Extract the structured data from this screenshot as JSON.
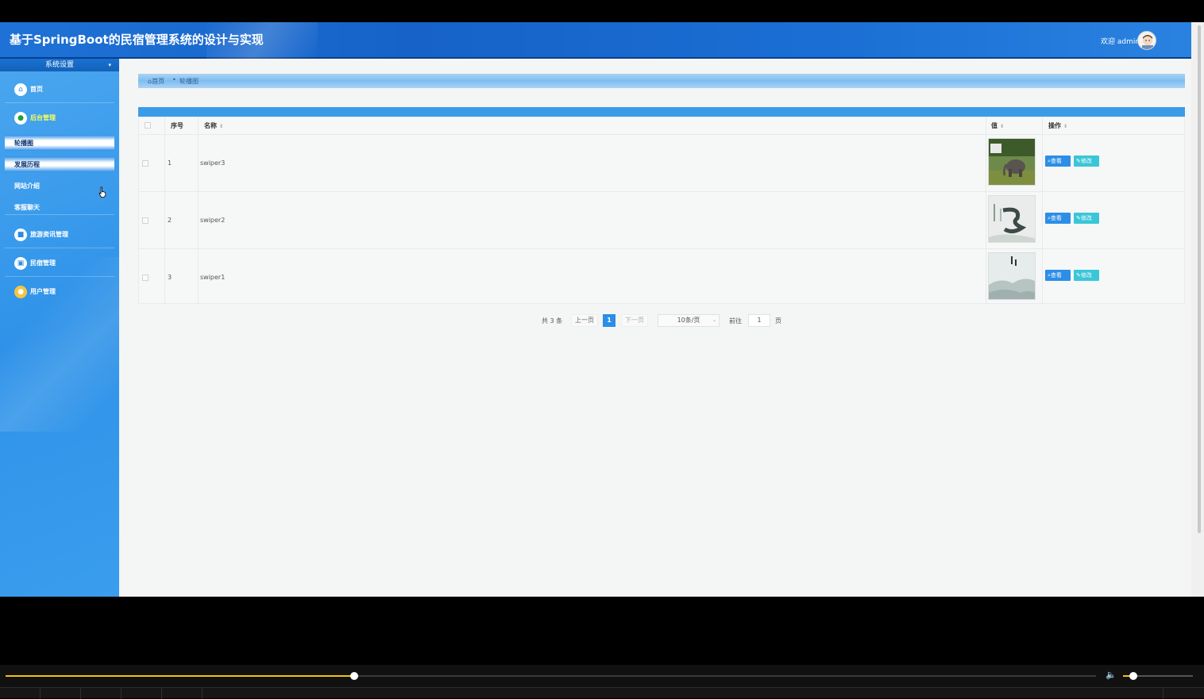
{
  "header": {
    "title": "基于SpringBoot的民宿管理系统的设计与实现",
    "welcome": "欢迎 admin"
  },
  "sidebar": {
    "title": "系统设置",
    "caret": "▾",
    "menu": [
      {
        "label": "首页",
        "icon": "home-icon"
      },
      {
        "label": "后台管理",
        "icon": "leaf-icon"
      },
      {
        "label": "旅游资讯管理",
        "icon": "square-icon"
      },
      {
        "label": "民宿管理",
        "icon": "bus-icon"
      },
      {
        "label": "用户管理",
        "icon": "user-icon"
      }
    ],
    "submenu": [
      {
        "label": "轮播图"
      },
      {
        "label": "发展历程"
      },
      {
        "label": "网站介绍"
      },
      {
        "label": "客服聊天"
      }
    ]
  },
  "breadcrumb": {
    "home": "首页",
    "separator": "•",
    "current": "轮播图"
  },
  "table": {
    "columns": {
      "index": "序号",
      "name": "名称",
      "value": "值",
      "action": "操作"
    },
    "rows": [
      {
        "index": "1",
        "name": "swiper3",
        "image": "elephant"
      },
      {
        "index": "2",
        "name": "swiper2",
        "image": "ink-painting"
      },
      {
        "index": "3",
        "name": "swiper1",
        "image": "misty-landscape"
      }
    ],
    "view_label": "查看",
    "edit_label": "修改"
  },
  "pagination": {
    "total": "共 3 条",
    "prev": "上一页",
    "current_page": "1",
    "next": "下一页",
    "page_size": "10条/页",
    "goto": "前往",
    "goto_value": "1",
    "page_unit": "页"
  },
  "player": {
    "progress": 0.32,
    "volume": 0.1
  },
  "colors": {
    "primary": "#2c8ee6",
    "header": "#1662c8",
    "edit": "#3ac6d8",
    "active_menu": "#f7ff5a"
  }
}
